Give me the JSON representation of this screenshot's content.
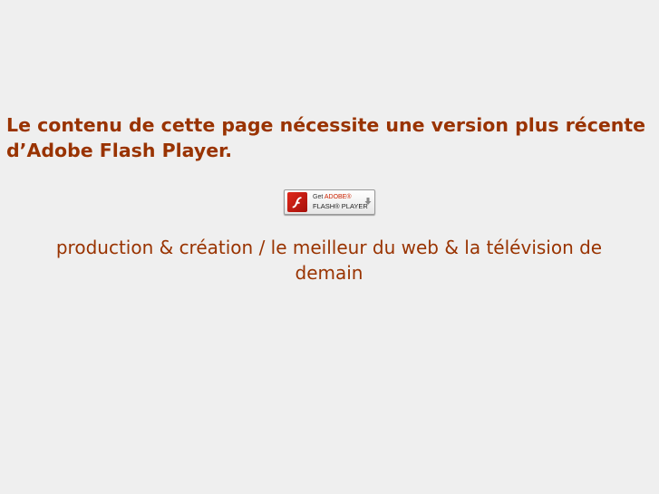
{
  "notice": {
    "text": "Le contenu de cette page nécessite une version plus récente d’Adobe Flash Player."
  },
  "flash_badge": {
    "line1_prefix": "Get ",
    "line1_brand": "ADOBE®",
    "line2": "FLASH® PLAYER",
    "icon": "flash-logo-icon",
    "download_icon": "download-arrow-icon"
  },
  "tagline": {
    "text": "production & création / le meilleur du web & la télévision de demain"
  },
  "colors": {
    "background": "#efefef",
    "text": "#993300"
  }
}
